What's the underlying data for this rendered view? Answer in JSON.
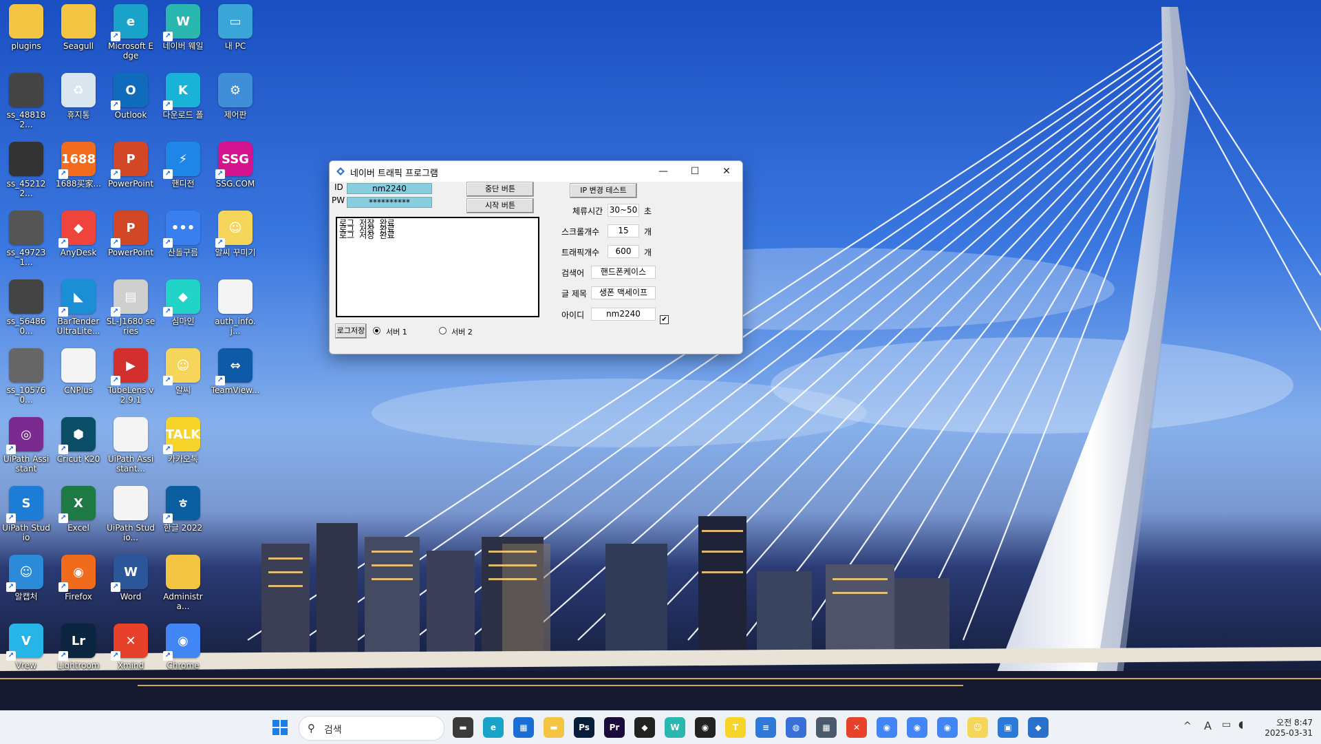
{
  "desktop": {
    "icons": [
      {
        "label": "plugins",
        "color": "#f4c542",
        "symbol": "",
        "icon": "folder-icon",
        "shortcut": false
      },
      {
        "label": "Seagull",
        "color": "#f4c542",
        "symbol": "",
        "icon": "folder-icon",
        "shortcut": false
      },
      {
        "label": "Microsoft Edge",
        "color": "#1aa3c9",
        "symbol": "e",
        "icon": "edge-icon",
        "shortcut": true
      },
      {
        "label": "네이버 웨일",
        "color": "#2ab7b0",
        "symbol": "W",
        "icon": "whale-browser-icon",
        "shortcut": true
      },
      {
        "label": "내 PC",
        "color": "#3aa6d8",
        "symbol": "▭",
        "icon": "pc-icon",
        "shortcut": false
      },
      {
        "label": "ss_488182...",
        "color": "#444",
        "symbol": "",
        "icon": "image-file-icon",
        "shortcut": false
      },
      {
        "label": "휴지통",
        "color": "#d9e6ef",
        "symbol": "♻",
        "icon": "recycle-bin-icon",
        "shortcut": false
      },
      {
        "label": "Outlook",
        "color": "#0f6cbd",
        "symbol": "O",
        "icon": "outlook-icon",
        "shortcut": true
      },
      {
        "label": "다운로드 폴",
        "color": "#19b3d8",
        "symbol": "K",
        "icon": "download-folder-icon",
        "shortcut": true
      },
      {
        "label": "제어판",
        "color": "#3f8fd8",
        "symbol": "⚙",
        "icon": "control-panel-icon",
        "shortcut": false
      },
      {
        "label": "ss_452122...",
        "color": "#333",
        "symbol": "",
        "icon": "image-file-icon",
        "shortcut": false
      },
      {
        "label": "1688买家...",
        "color": "#f36b1c",
        "symbol": "1688",
        "icon": "1688-icon",
        "shortcut": true
      },
      {
        "label": "PowerPoint",
        "color": "#d24726",
        "symbol": "P",
        "icon": "powerpoint-icon",
        "shortcut": true
      },
      {
        "label": "핸디전",
        "color": "#1f86e8",
        "symbol": "⚡",
        "icon": "handy-icon",
        "shortcut": true
      },
      {
        "label": "SSG.COM",
        "color": "#d4148f",
        "symbol": "SSG",
        "icon": "ssg-icon",
        "shortcut": true
      },
      {
        "label": "ss_497231...",
        "color": "#555",
        "symbol": "",
        "icon": "image-file-icon",
        "shortcut": false
      },
      {
        "label": "AnyDesk",
        "color": "#ef443b",
        "symbol": "◆",
        "icon": "anydesk-icon",
        "shortcut": true
      },
      {
        "label": "PowerPoint",
        "color": "#d24726",
        "symbol": "P",
        "icon": "powerpoint-icon",
        "shortcut": true
      },
      {
        "label": "산돌구름",
        "color": "#3a7ff0",
        "symbol": "•••",
        "icon": "sandoll-icon",
        "shortcut": true
      },
      {
        "label": "알씨 꾸미기",
        "color": "#f5d65a",
        "symbol": "☺",
        "icon": "alsee-icon",
        "shortcut": true
      },
      {
        "label": "ss_564860...",
        "color": "#444",
        "symbol": "",
        "icon": "image-file-icon",
        "shortcut": false
      },
      {
        "label": "BarTender UltraLite...",
        "color": "#1b8fd6",
        "symbol": "◣",
        "icon": "bartender-icon",
        "shortcut": true
      },
      {
        "label": "SL-J1680 series",
        "color": "#cfcfcf",
        "symbol": "▤",
        "icon": "printer-icon",
        "shortcut": true
      },
      {
        "label": "심마인",
        "color": "#22d3c8",
        "symbol": "◆",
        "icon": "cube-icon",
        "shortcut": true
      },
      {
        "label": "auth_info.j...",
        "color": "#f4f4f4",
        "symbol": "",
        "icon": "document-icon",
        "shortcut": false
      },
      {
        "label": "ss_105760...",
        "color": "#666",
        "symbol": "",
        "icon": "image-file-icon",
        "shortcut": false
      },
      {
        "label": "CNPlus",
        "color": "#f4f4f4",
        "symbol": "",
        "icon": "document-icon",
        "shortcut": false
      },
      {
        "label": "TubeLens v2.9.1",
        "color": "#d32f2f",
        "symbol": "▶",
        "icon": "tubelens-icon",
        "shortcut": true
      },
      {
        "label": "알씨",
        "color": "#f5d65a",
        "symbol": "☺",
        "icon": "alsee-icon",
        "shortcut": true
      },
      {
        "label": "TeamView...",
        "color": "#0e5aa7",
        "symbol": "⇔",
        "icon": "teamviewer-icon",
        "shortcut": true
      },
      {
        "label": "UiPath Assistant",
        "color": "#7a2b8f",
        "symbol": "◎",
        "icon": "uipath-assistant-icon",
        "shortcut": true
      },
      {
        "label": "Cricut K20",
        "color": "#0a4d66",
        "symbol": "⬢",
        "icon": "cricut-icon",
        "shortcut": true
      },
      {
        "label": "UiPath Assistant...",
        "color": "#f4f4f4",
        "symbol": "",
        "icon": "document-icon",
        "shortcut": false
      },
      {
        "label": "카카오톡",
        "color": "#f7d42a",
        "symbol": "TALK",
        "icon": "kakaotalk-icon",
        "shortcut": true
      },
      {
        "label": "",
        "color": "",
        "symbol": "",
        "icon": "",
        "shortcut": false
      },
      {
        "label": "UiPath Studio",
        "color": "#1c7cd6",
        "symbol": "S",
        "icon": "uipath-studio-icon",
        "shortcut": true
      },
      {
        "label": "Excel",
        "color": "#1d7a45",
        "symbol": "X",
        "icon": "excel-icon",
        "shortcut": true
      },
      {
        "label": "UiPath Studio...",
        "color": "#f4f4f4",
        "symbol": "",
        "icon": "document-icon",
        "shortcut": false
      },
      {
        "label": "한글 2022",
        "color": "#0b5fa0",
        "symbol": "ㅎ",
        "icon": "hangul-icon",
        "shortcut": true
      },
      {
        "label": "",
        "color": "",
        "symbol": "",
        "icon": "",
        "shortcut": false
      },
      {
        "label": "알캡처",
        "color": "#2b8bd8",
        "symbol": "☺",
        "icon": "alcapture-icon",
        "shortcut": true
      },
      {
        "label": "Firefox",
        "color": "#f06b1c",
        "symbol": "◉",
        "icon": "firefox-icon",
        "shortcut": true
      },
      {
        "label": "Word",
        "color": "#2b579a",
        "symbol": "W",
        "icon": "word-icon",
        "shortcut": true
      },
      {
        "label": "Administra...",
        "color": "#f4c542",
        "symbol": "",
        "icon": "folder-icon",
        "shortcut": false
      },
      {
        "label": "",
        "color": "",
        "symbol": "",
        "icon": "",
        "shortcut": false
      },
      {
        "label": "Vrew",
        "color": "#27b5e8",
        "symbol": "V",
        "icon": "vrew-icon",
        "shortcut": true
      },
      {
        "label": "Lightroom",
        "color": "#0b2540",
        "symbol": "Lr",
        "icon": "lightroom-icon",
        "shortcut": true
      },
      {
        "label": "Xmind",
        "color": "#e8412b",
        "symbol": "✕",
        "icon": "xmind-icon",
        "shortcut": true
      },
      {
        "label": "Chrome",
        "color": "#4285f4",
        "symbol": "◉",
        "icon": "chrome-icon",
        "shortcut": true
      },
      {
        "label": "",
        "color": "",
        "symbol": "",
        "icon": "",
        "shortcut": false
      }
    ]
  },
  "window": {
    "title": "네이버 트래픽 프로그램",
    "minimize": "—",
    "maximize": "☐",
    "close": "✕",
    "id_label": "ID",
    "id_value": "nm2240",
    "pw_label": "PW",
    "pw_value": "**********",
    "stop_button": "중단 버튼",
    "start_button": "시작 버튼",
    "ip_test_button": "IP 변경 테스트",
    "log_lines": [
      "로그 저장 완료",
      "로그 저장 완료",
      "로그 저장 완료"
    ],
    "log_save_button": "로그저장",
    "server1_label": "서버 1",
    "server2_label": "서버 2",
    "stay_time_label": "체류시간",
    "stay_time_value": "30~50",
    "stay_time_unit": "초",
    "scroll_count_label": "스크롤개수",
    "scroll_count_value": "15",
    "scroll_count_unit": "개",
    "traffic_count_label": "트래픽개수",
    "traffic_count_value": "600",
    "traffic_count_unit": "개",
    "keyword_label": "검색어",
    "keyword_value": "핸드폰케이스",
    "post_title_label": "글 제목",
    "post_title_value": "생폰 맥세이프",
    "user_id_label": "아이디",
    "user_id_value": "nm2240",
    "checkbox_checked": true
  },
  "taskbar": {
    "search_placeholder": "검색",
    "time": "오전 8:47",
    "date": "2025-03-31",
    "ime": "A",
    "tray_expand": "^",
    "apps": [
      {
        "icon": "file-explorer-icon",
        "color": "#3a3a3a",
        "symbol": "▬"
      },
      {
        "icon": "edge-icon",
        "color": "#1aa3c9",
        "symbol": "e"
      },
      {
        "icon": "store-icon",
        "color": "#1b6ed6",
        "symbol": "▦"
      },
      {
        "icon": "folder-icon",
        "color": "#f4c542",
        "symbol": "▬"
      },
      {
        "icon": "photoshop-icon",
        "color": "#061e3a",
        "symbol": "Ps"
      },
      {
        "icon": "premiere-icon",
        "color": "#1a0b3a",
        "symbol": "Pr"
      },
      {
        "icon": "figma-icon",
        "color": "#222",
        "symbol": "◆"
      },
      {
        "icon": "whale-browser-icon",
        "color": "#2ab7b0",
        "symbol": "W"
      },
      {
        "icon": "capture-icon",
        "color": "#222",
        "symbol": "◉"
      },
      {
        "icon": "kakaotalk-icon",
        "color": "#f7d42a",
        "symbol": "T"
      },
      {
        "icon": "notepad-icon",
        "color": "#2f7ad8",
        "symbol": "≡"
      },
      {
        "icon": "globe-icon",
        "color": "#3a6fd8",
        "symbol": "◍"
      },
      {
        "icon": "calculator-icon",
        "color": "#4a5a6a",
        "symbol": "▦"
      },
      {
        "icon": "xmind-icon",
        "color": "#e8412b",
        "symbol": "✕"
      },
      {
        "icon": "chrome-icon",
        "color": "#4285f4",
        "symbol": "◉"
      },
      {
        "icon": "chrome-icon",
        "color": "#4285f4",
        "symbol": "◉"
      },
      {
        "icon": "chrome-icon",
        "color": "#4285f4",
        "symbol": "◉"
      },
      {
        "icon": "alsee-icon",
        "color": "#f5d65a",
        "symbol": "☺"
      },
      {
        "icon": "window-icon",
        "color": "#2b7ad8",
        "symbol": "▣"
      },
      {
        "icon": "traffic-program-icon",
        "color": "#2a6fc9",
        "symbol": "◆"
      }
    ]
  }
}
